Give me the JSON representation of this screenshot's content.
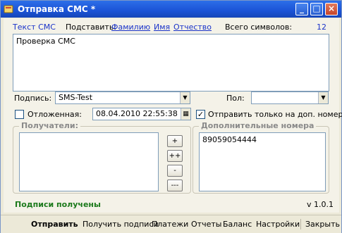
{
  "window": {
    "title": "Отправка СМС *"
  },
  "header": {
    "text_label": "Текст СМС",
    "insert_label": "Подставить:",
    "insert_links": [
      "Фамилию",
      "Имя",
      "Отчество"
    ],
    "char_count_label": "Всего символов:",
    "char_count_value": "12"
  },
  "message": {
    "text": "Проверка СМС"
  },
  "signature": {
    "label": "Подпись:",
    "value": "SMS-Test"
  },
  "gender": {
    "label": "Пол:",
    "value": ""
  },
  "delayed": {
    "checkbox_label": "Отложенная:",
    "checked": false,
    "datetime": "08.04.2010 22:55:38"
  },
  "extra_only": {
    "checkbox_label": "Отправить только на доп. номера",
    "checked": true
  },
  "recipients": {
    "legend": "Получатели:",
    "buttons": [
      "+",
      "++",
      "-",
      "---"
    ]
  },
  "additional": {
    "legend": "Дополнительные номера",
    "numbers": "89059054444"
  },
  "status": {
    "text": "Подписи получены",
    "color": "#1c7a1c",
    "version": "v 1.0.1"
  },
  "footer": {
    "send": "Отправить",
    "get_signatures": "Получить подписи",
    "payments": "Платежи",
    "reports": "Отчеты",
    "balance": "Баланс",
    "settings": "Настройки",
    "close": "Закрыть"
  }
}
